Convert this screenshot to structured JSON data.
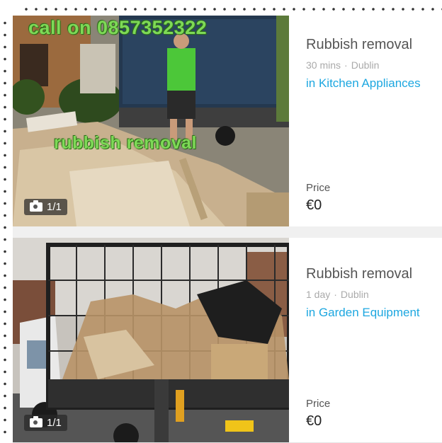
{
  "listings": [
    {
      "title": "Rubbish removal",
      "time": "30 mins",
      "location": "Dublin",
      "category": "in Kitchen Appliances",
      "price_label": "Price",
      "price": "€0",
      "photo_count": "1/1",
      "overlay_phone": "call on 0857352322",
      "overlay_service": "rubbish removal"
    },
    {
      "title": "Rubbish removal",
      "time": "1 day",
      "location": "Dublin",
      "category": "in Garden Equipment",
      "price_label": "Price",
      "price": "€0",
      "photo_count": "1/1"
    }
  ],
  "meta_separator": "·",
  "colors": {
    "category_link": "#1da7e0",
    "overlay_green": "#7ed957",
    "title": "#555555"
  }
}
